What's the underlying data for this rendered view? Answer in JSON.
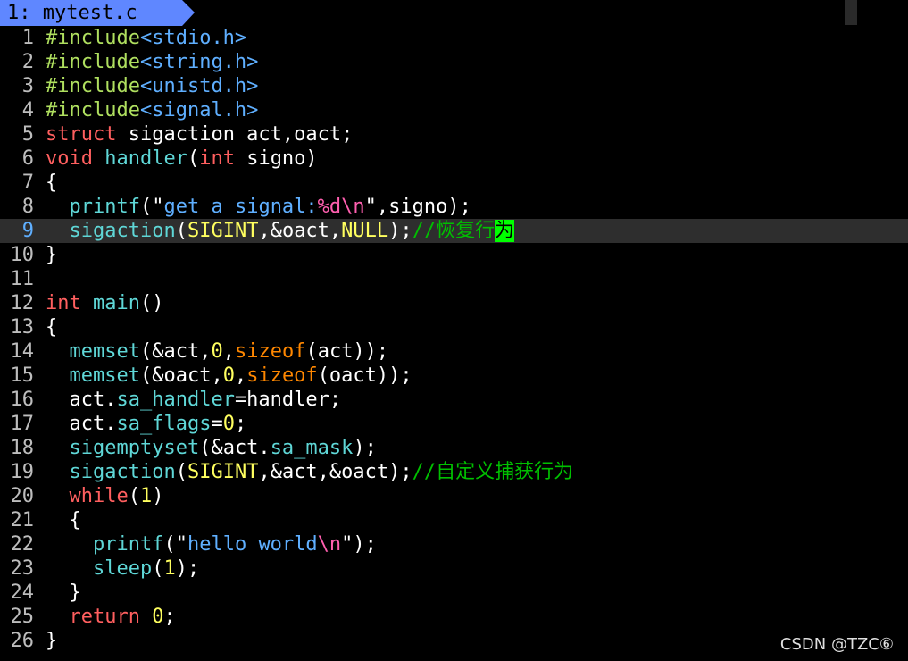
{
  "tabline": {
    "tab_label": "1: mytest.c"
  },
  "editor": {
    "lines": [
      {
        "num": "1",
        "segs": [
          [
            "#include",
            "pp"
          ],
          [
            "<stdio.h>",
            "inc"
          ]
        ]
      },
      {
        "num": "2",
        "segs": [
          [
            "#include",
            "pp"
          ],
          [
            "<string.h>",
            "inc"
          ]
        ]
      },
      {
        "num": "3",
        "segs": [
          [
            "#include",
            "pp"
          ],
          [
            "<unistd.h>",
            "inc"
          ]
        ]
      },
      {
        "num": "4",
        "segs": [
          [
            "#include",
            "pp"
          ],
          [
            "<signal.h>",
            "inc"
          ]
        ]
      },
      {
        "num": "5",
        "segs": [
          [
            "struct",
            "kw"
          ],
          [
            " sigaction act,oact;",
            ""
          ]
        ]
      },
      {
        "num": "6",
        "segs": [
          [
            "void",
            "kw"
          ],
          [
            " ",
            ""
          ],
          [
            "handler",
            "fn"
          ],
          [
            "(",
            ""
          ],
          [
            "int",
            "kw"
          ],
          [
            " signo)",
            ""
          ]
        ]
      },
      {
        "num": "7",
        "segs": [
          [
            "{",
            ""
          ]
        ]
      },
      {
        "num": "8",
        "segs": [
          [
            "  ",
            ""
          ],
          [
            "printf",
            "fn"
          ],
          [
            "(\"",
            ""
          ],
          [
            "get a signal:",
            "str"
          ],
          [
            "%d\\n",
            "fmt"
          ],
          [
            "\",signo);",
            ""
          ]
        ]
      },
      {
        "num": "9",
        "cur": true,
        "segs": [
          [
            "  ",
            ""
          ],
          [
            "sigaction",
            "fn"
          ],
          [
            "(",
            ""
          ],
          [
            "SIGINT",
            "cst"
          ],
          [
            ",&oact,",
            ""
          ],
          [
            "NULL",
            "cst"
          ],
          [
            ");",
            ""
          ],
          [
            "//恢复行",
            "cmt"
          ],
          [
            "为",
            "hl"
          ]
        ]
      },
      {
        "num": "10",
        "segs": [
          [
            "}",
            ""
          ]
        ]
      },
      {
        "num": "11",
        "segs": []
      },
      {
        "num": "12",
        "segs": [
          [
            "int",
            "kw"
          ],
          [
            " ",
            ""
          ],
          [
            "main",
            "fn"
          ],
          [
            "()",
            ""
          ]
        ]
      },
      {
        "num": "13",
        "segs": [
          [
            "{",
            ""
          ]
        ]
      },
      {
        "num": "14",
        "segs": [
          [
            "  ",
            ""
          ],
          [
            "memset",
            "fn"
          ],
          [
            "(&act,",
            ""
          ],
          [
            "0",
            "num"
          ],
          [
            ",",
            ""
          ],
          [
            "sizeof",
            "sz"
          ],
          [
            "(act));",
            ""
          ]
        ]
      },
      {
        "num": "15",
        "segs": [
          [
            "  ",
            ""
          ],
          [
            "memset",
            "fn"
          ],
          [
            "(&oact,",
            ""
          ],
          [
            "0",
            "num"
          ],
          [
            ",",
            ""
          ],
          [
            "sizeof",
            "sz"
          ],
          [
            "(oact));",
            ""
          ]
        ]
      },
      {
        "num": "16",
        "segs": [
          [
            "  act.",
            ""
          ],
          [
            "sa_handler",
            "fld"
          ],
          [
            "=handler;",
            ""
          ]
        ]
      },
      {
        "num": "17",
        "segs": [
          [
            "  act.",
            ""
          ],
          [
            "sa_flags",
            "fld"
          ],
          [
            "=",
            ""
          ],
          [
            "0",
            "num"
          ],
          [
            ";",
            ""
          ]
        ]
      },
      {
        "num": "18",
        "segs": [
          [
            "  ",
            ""
          ],
          [
            "sigemptyset",
            "fn"
          ],
          [
            "(&act.",
            ""
          ],
          [
            "sa_mask",
            "fld"
          ],
          [
            ");",
            ""
          ]
        ]
      },
      {
        "num": "19",
        "segs": [
          [
            "  ",
            ""
          ],
          [
            "sigaction",
            "fn"
          ],
          [
            "(",
            ""
          ],
          [
            "SIGINT",
            "cst"
          ],
          [
            ",&act,&oact);",
            ""
          ],
          [
            "//自定义捕获行为",
            "cmt"
          ]
        ]
      },
      {
        "num": "20",
        "segs": [
          [
            "  ",
            ""
          ],
          [
            "while",
            "kw"
          ],
          [
            "(",
            ""
          ],
          [
            "1",
            "num"
          ],
          [
            ")",
            ""
          ]
        ]
      },
      {
        "num": "21",
        "segs": [
          [
            "  {",
            ""
          ]
        ]
      },
      {
        "num": "22",
        "segs": [
          [
            "    ",
            ""
          ],
          [
            "printf",
            "fn"
          ],
          [
            "(\"",
            ""
          ],
          [
            "hello world",
            "str"
          ],
          [
            "\\n",
            "fmt"
          ],
          [
            "\");",
            ""
          ]
        ]
      },
      {
        "num": "23",
        "segs": [
          [
            "    ",
            ""
          ],
          [
            "sleep",
            "fn"
          ],
          [
            "(",
            ""
          ],
          [
            "1",
            "num"
          ],
          [
            ");",
            ""
          ]
        ]
      },
      {
        "num": "24",
        "segs": [
          [
            "  }",
            ""
          ]
        ]
      },
      {
        "num": "25",
        "segs": [
          [
            "  ",
            ""
          ],
          [
            "return",
            "kw"
          ],
          [
            " ",
            ""
          ],
          [
            "0",
            "num"
          ],
          [
            ";",
            ""
          ]
        ]
      },
      {
        "num": "26",
        "segs": [
          [
            "}",
            ""
          ]
        ]
      }
    ]
  },
  "watermark": {
    "text": "CSDN @TZC⑥"
  },
  "colors": {
    "tab_bg": "#5f87ff",
    "preproc": "#afdf5f",
    "keyword": "#ff5f5f",
    "function": "#5fd7d7",
    "string": "#5fafff",
    "comment": "#00c000",
    "number": "#ffff5f",
    "highlight": "#00ff00"
  }
}
